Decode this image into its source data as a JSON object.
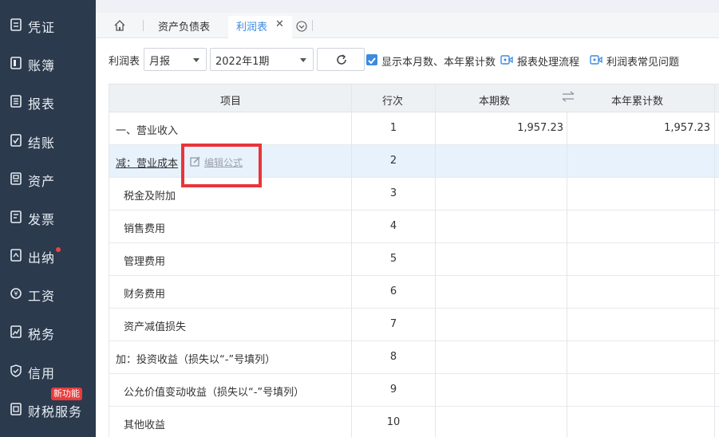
{
  "sidebar": {
    "items": [
      {
        "label": "凭证",
        "icon": "voucher-icon"
      },
      {
        "label": "账簿",
        "icon": "ledger-icon"
      },
      {
        "label": "报表",
        "icon": "report-icon"
      },
      {
        "label": "结账",
        "icon": "closing-icon"
      },
      {
        "label": "资产",
        "icon": "asset-icon"
      },
      {
        "label": "发票",
        "icon": "invoice-icon"
      },
      {
        "label": "出纳",
        "icon": "cashier-icon"
      },
      {
        "label": "工资",
        "icon": "salary-icon"
      },
      {
        "label": "税务",
        "icon": "tax-icon"
      },
      {
        "label": "信用",
        "icon": "credit-icon"
      },
      {
        "label": "财税服务",
        "icon": "service-icon"
      }
    ],
    "new_badge": "新功能"
  },
  "tabs": {
    "home_icon": "home-icon",
    "items": [
      {
        "label": "资产负债表"
      },
      {
        "label": "利润表"
      }
    ]
  },
  "toolbar": {
    "label": "利润表",
    "period_type": "月报",
    "period": "2022年1期",
    "checkbox_label": "显示本月数、本年累计数",
    "link1": "报表处理流程",
    "link2": "利润表常见问题"
  },
  "table": {
    "headers": {
      "item": "项目",
      "line": "行次",
      "current": "本期数",
      "ytd": "本年累计数"
    },
    "edit_formula": "编辑公式",
    "rows": [
      {
        "name": "一、营业收入",
        "line": "1",
        "current": "1,957.23",
        "ytd": "1,957.23"
      },
      {
        "name": "减：营业成本",
        "line": "2",
        "current": "",
        "ytd": ""
      },
      {
        "name": "税金及附加",
        "line": "3",
        "current": "",
        "ytd": ""
      },
      {
        "name": "销售费用",
        "line": "4",
        "current": "",
        "ytd": ""
      },
      {
        "name": "管理费用",
        "line": "5",
        "current": "",
        "ytd": ""
      },
      {
        "name": "财务费用",
        "line": "6",
        "current": "",
        "ytd": ""
      },
      {
        "name": "资产减值损失",
        "line": "7",
        "current": "",
        "ytd": ""
      },
      {
        "name": "加：投资收益（损失以“-”号填列）",
        "line": "8",
        "current": "",
        "ytd": ""
      },
      {
        "name": "公允价值变动收益（损失以“-”号填列）",
        "line": "9",
        "current": "",
        "ytd": ""
      },
      {
        "name": "其他收益",
        "line": "10",
        "current": "",
        "ytd": ""
      }
    ]
  },
  "colors": {
    "sidebar_bg": "#2b3a4d",
    "accent": "#3c8be0",
    "highlight_box": "#e8353b"
  }
}
